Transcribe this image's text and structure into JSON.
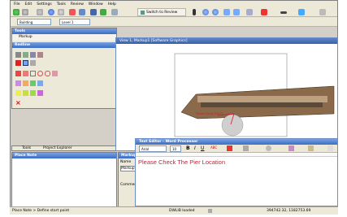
{
  "menu": [
    "File",
    "Edit",
    "Settings",
    "Tools",
    "Review",
    "Window",
    "Help"
  ],
  "toolbar": {
    "switch_label": "Switch to Review",
    "combo1": "Building",
    "combo2": "Level 1"
  },
  "tools_panel": {
    "title": "Tools",
    "markup_label": "Markup",
    "redline_label": "Redline"
  },
  "view": {
    "title": "View 1, Markup1 [Software Graphics]"
  },
  "markup_note": "Please Check The Pi...",
  "tabs": {
    "tools": "Tools",
    "explorer": "Project Explorer"
  },
  "place_note_title": "Place Note",
  "side_panel": {
    "title": "Markup",
    "items": [
      "Name",
      "Markup1",
      "Comment"
    ]
  },
  "text_editor": {
    "title": "Text Editor - Word Processor",
    "font": "Arial",
    "size": "10",
    "body": "Please Check The Pier Location"
  },
  "status": {
    "left": "Place Note > Define start point",
    "middle": "DWLIB loaded",
    "coords": "394742.32, 1182753.69"
  },
  "colors": {
    "note_red": "#e0142c",
    "title_blue": "#3a6cc8"
  }
}
